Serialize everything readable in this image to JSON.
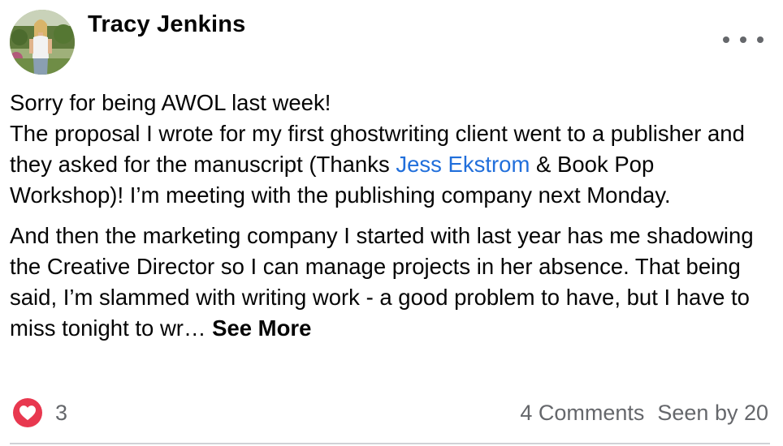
{
  "post": {
    "author": "Tracy Jenkins",
    "body": {
      "line1": "Sorry for being AWOL last week!",
      "p1_before_mention": "The proposal I wrote for my first ghostwriting client went to a publisher and they asked for the manuscript (Thanks ",
      "mention": "Jess Ekstrom",
      "p1_after_mention": " & Book Pop Workshop)! I’m meeting with the publishing company next Monday.",
      "p2": "And then the marketing company I started with last year has me shadowing the Creative Director so I can manage projects in her absence. That being said, I’m slammed with writing work - a good problem to have, but I have to miss tonight to wr… ",
      "see_more": "See More"
    },
    "reactions": {
      "icon": "heart-icon",
      "count": "3"
    },
    "comments_label": "4 Comments",
    "seen_label": "Seen by 20"
  },
  "icons": {
    "options": "more-horizontal-icon",
    "reaction": "heart-icon"
  },
  "colors": {
    "mention": "#216fdb",
    "heart": "#e8384f",
    "secondary_text": "#65676b"
  }
}
